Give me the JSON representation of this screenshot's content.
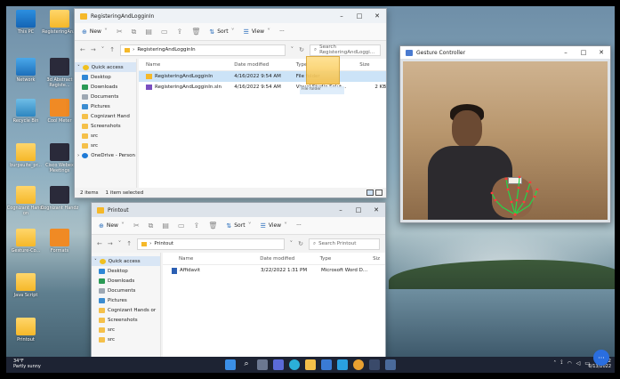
{
  "desktop": {
    "icons": [
      {
        "label": "This PC"
      },
      {
        "label": "RegisteringAn..."
      },
      {
        "label": "Network"
      },
      {
        "label": "3d Abstract Registe..."
      },
      {
        "label": "Recycle Bin"
      },
      {
        "label": "Cool Meter"
      },
      {
        "label": "burpsuite_pr..."
      },
      {
        "label": "Cisco Webex Meetings"
      },
      {
        "label": "Cognizant Hands on"
      },
      {
        "label": "Cognizant Handz"
      },
      {
        "label": "Gesture-Co..."
      },
      {
        "label": "Formats"
      },
      {
        "label": "Java Script"
      },
      {
        "label": "Printout"
      }
    ]
  },
  "window1": {
    "title": "RegisteringAndLogginIn",
    "cmd": {
      "new": "New",
      "sort": "Sort",
      "view": "View",
      "more": "···"
    },
    "address": "RegisteringAndLogginIn",
    "search_placeholder": "Search RegisteringAndLoggi...",
    "nav": {
      "quick_access": "Quick access",
      "items": [
        "Desktop",
        "Downloads",
        "Documents",
        "Pictures",
        "Cognizant Hand",
        "Screenshots",
        "src",
        "src"
      ],
      "onedrive": "OneDrive - Person"
    },
    "columns": {
      "name": "Name",
      "date": "Date modified",
      "type": "Type",
      "size": "Size"
    },
    "rows": [
      {
        "name": "RegisteringAndLogginIn",
        "date": "4/16/2022 9:54 AM",
        "type": "File folder",
        "size": ""
      },
      {
        "name": "RegisteringAndLogginIn.sln",
        "date": "4/16/2022 9:54 AM",
        "type": "Visual Studio Solut...",
        "size": "2 KB"
      }
    ],
    "status": {
      "items": "2 items",
      "selected": "1 item selected"
    },
    "drag_label": "File folder"
  },
  "window2": {
    "title": "Printout",
    "cmd": {
      "new": "New",
      "sort": "Sort",
      "view": "View",
      "more": "···"
    },
    "address": "Printout",
    "search_placeholder": "Search Printout",
    "nav": {
      "quick_access": "Quick access",
      "items": [
        "Desktop",
        "Downloads",
        "Documents",
        "Pictures",
        "Cognizant Hands or",
        "Screenshots",
        "src",
        "src"
      ]
    },
    "columns": {
      "name": "Name",
      "date": "Date modified",
      "type": "Type",
      "size": "Siz"
    },
    "rows": [
      {
        "name": "Affidavit",
        "date": "3/22/2022 1:31 PM",
        "type": "Microsoft Word D..."
      }
    ]
  },
  "gesture": {
    "title": "Gesture Controller"
  },
  "taskbar": {
    "temp": "34°F",
    "weather": "Partly sunny",
    "time": "10:22",
    "date": "6/13/2022",
    "fab_icon": "···"
  },
  "colors": {
    "accent": "#2a6ebb",
    "selection": "#cce3f7",
    "folder": "#f5b829",
    "taskbar": "#1d2333"
  }
}
